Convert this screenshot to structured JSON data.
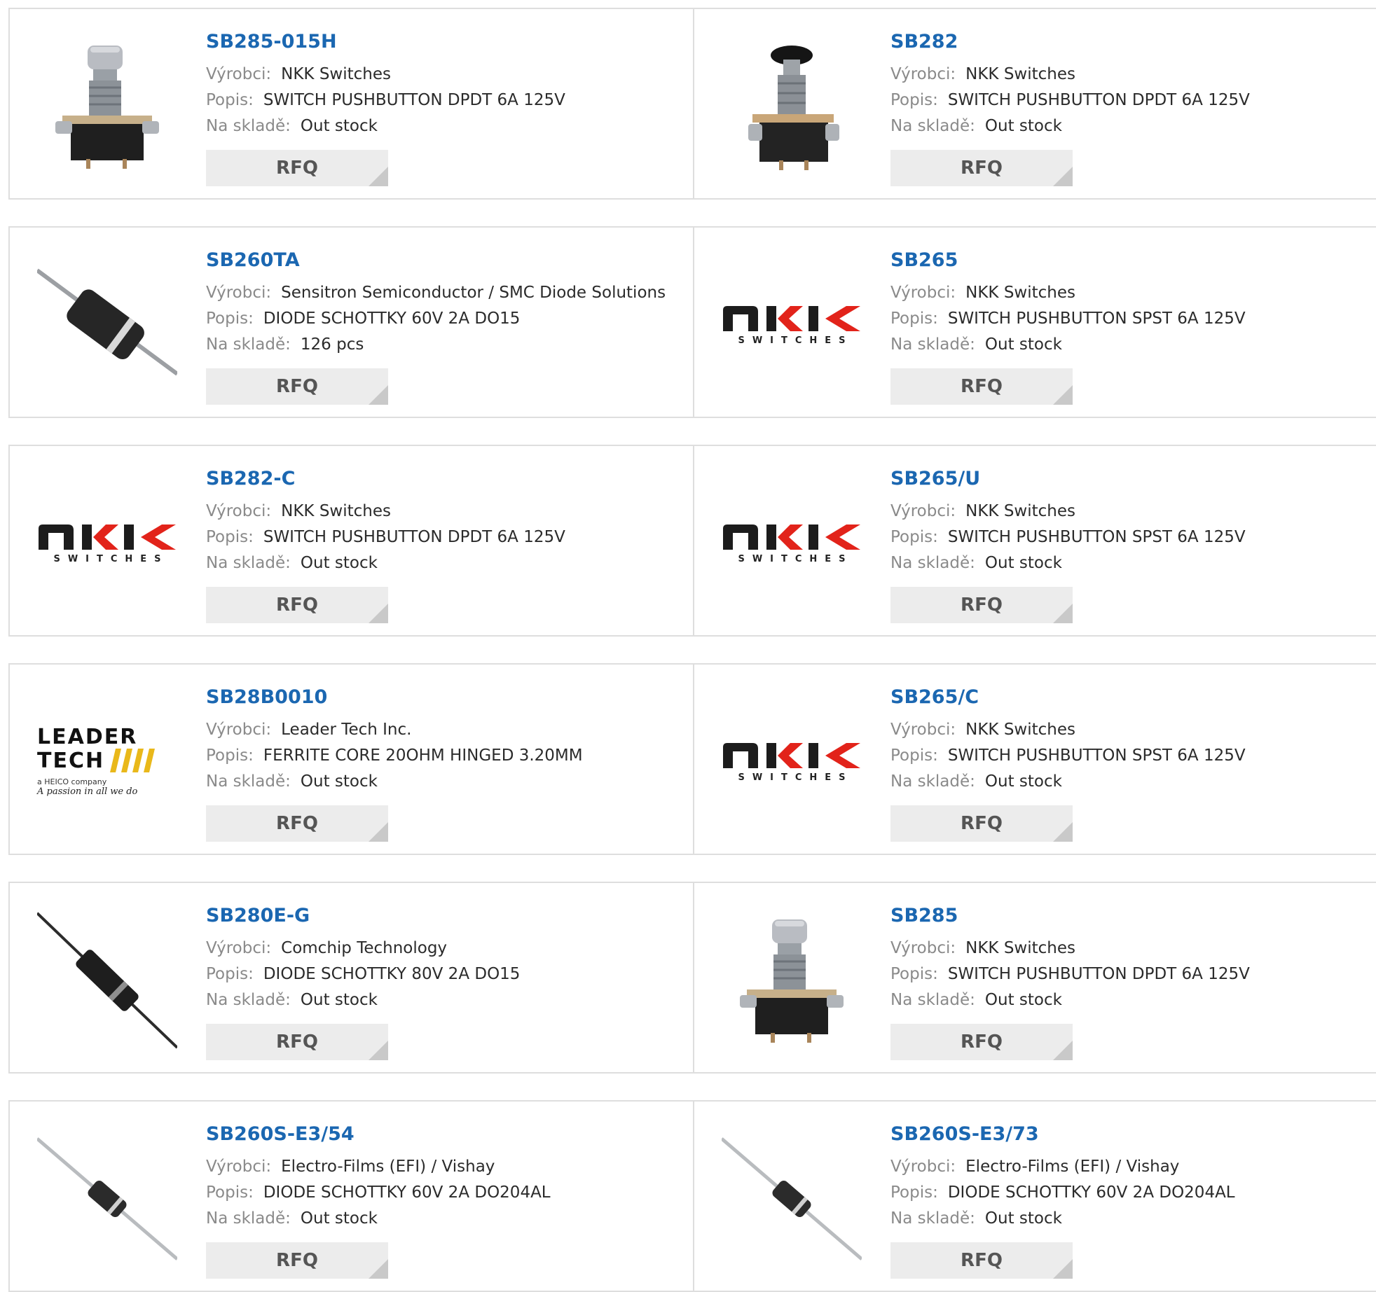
{
  "labels": {
    "manufacturer": "Výrobci:",
    "description": "Popis:",
    "stock": "Na skladě:",
    "rfq": "RFQ"
  },
  "rows": [
    [
      {
        "name": "SB285-015H",
        "manufacturer": "NKK Switches",
        "description": "SWITCH PUSHBUTTON DPDT 6A 125V",
        "stock": "Out stock",
        "image": "pushbutton-switch-photo"
      },
      {
        "name": "SB282",
        "manufacturer": "NKK Switches",
        "description": "SWITCH PUSHBUTTON DPDT 6A 125V",
        "stock": "Out stock",
        "image": "pushbutton-switch-black-photo"
      }
    ],
    [
      {
        "name": "SB260TA",
        "manufacturer": "Sensitron Semiconductor / SMC Diode Solutions",
        "description": "DIODE SCHOTTKY 60V 2A DO15",
        "stock": "126 pcs",
        "image": "axial-diode-large-photo"
      },
      {
        "name": "SB265",
        "manufacturer": "NKK Switches",
        "description": "SWITCH PUSHBUTTON SPST 6A 125V",
        "stock": "Out stock",
        "image": "nkk-logo"
      }
    ],
    [
      {
        "name": "SB282-C",
        "manufacturer": "NKK Switches",
        "description": "SWITCH PUSHBUTTON DPDT 6A 125V",
        "stock": "Out stock",
        "image": "nkk-logo"
      },
      {
        "name": "SB265/U",
        "manufacturer": "NKK Switches",
        "description": "SWITCH PUSHBUTTON SPST 6A 125V",
        "stock": "Out stock",
        "image": "nkk-logo"
      }
    ],
    [
      {
        "name": "SB28B0010",
        "manufacturer": "Leader Tech Inc.",
        "description": "FERRITE CORE 20OHM HINGED 3.20MM",
        "stock": "Out stock",
        "image": "leader-tech-logo"
      },
      {
        "name": "SB265/C",
        "manufacturer": "NKK Switches",
        "description": "SWITCH PUSHBUTTON SPST 6A 125V",
        "stock": "Out stock",
        "image": "nkk-logo"
      }
    ],
    [
      {
        "name": "SB280E-G",
        "manufacturer": "Comchip Technology",
        "description": "DIODE SCHOTTKY 80V 2A DO15",
        "stock": "Out stock",
        "image": "axial-diode-thin-photo"
      },
      {
        "name": "SB285",
        "manufacturer": "NKK Switches",
        "description": "SWITCH PUSHBUTTON DPDT 6A 125V",
        "stock": "Out stock",
        "image": "pushbutton-switch-photo"
      }
    ],
    [
      {
        "name": "SB260S-E3/54",
        "manufacturer": "Electro-Films (EFI) / Vishay",
        "description": "DIODE SCHOTTKY 60V 2A DO204AL",
        "stock": "Out stock",
        "image": "axial-diode-small-photo"
      },
      {
        "name": "SB260S-E3/73",
        "manufacturer": "Electro-Films (EFI) / Vishay",
        "description": "DIODE SCHOTTKY 60V 2A DO204AL",
        "stock": "Out stock",
        "image": "axial-diode-small-photo"
      }
    ]
  ],
  "logos": {
    "nkk_top": "NKK",
    "nkk_sub": "SWITCHES",
    "leader_line1": "LEADER",
    "leader_line2": "TECH",
    "leader_small": "a HEICO company",
    "leader_tag": "A passion in all we do"
  },
  "colors": {
    "link": "#1b67b1",
    "label": "#8a8a8a",
    "border": "#dedede",
    "button_bg": "#ececec",
    "nkk_red": "#e2231a",
    "leader_yellow": "#e9b81a"
  }
}
